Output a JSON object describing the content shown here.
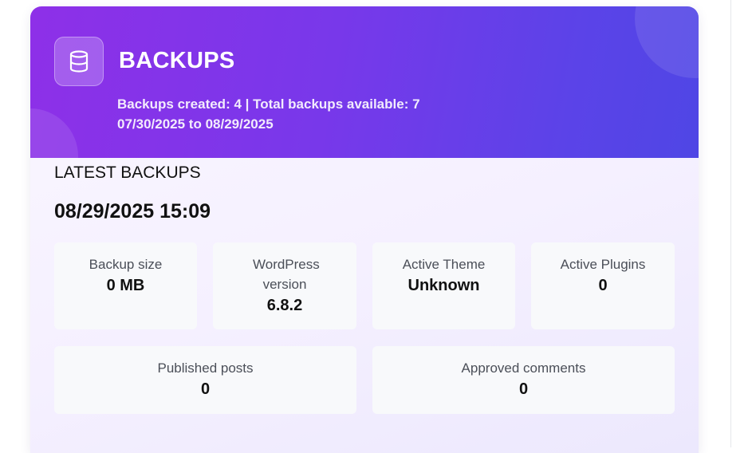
{
  "header": {
    "title": "BACKUPS",
    "stats_line": "Backups created: 4 | Total backups available: 7",
    "date_range": "07/30/2025 to 08/29/2025",
    "icon": "database-icon"
  },
  "latest": {
    "heading": "LATEST BACKUPS",
    "date": "08/29/2025 15:09"
  },
  "stats": [
    {
      "label": "Backup size",
      "value": "0 MB"
    },
    {
      "label": "WordPress version",
      "value": "6.8.2"
    },
    {
      "label": "Active Theme",
      "value": "Unknown"
    },
    {
      "label": "Active Plugins",
      "value": "0"
    },
    {
      "label": "Published posts",
      "value": "0"
    },
    {
      "label": "Approved comments",
      "value": "0"
    }
  ],
  "colors": {
    "header_gradient_start": "#8e30e8",
    "header_gradient_end": "#4f46e5",
    "stat_box_bg": "#f8f9fb"
  }
}
